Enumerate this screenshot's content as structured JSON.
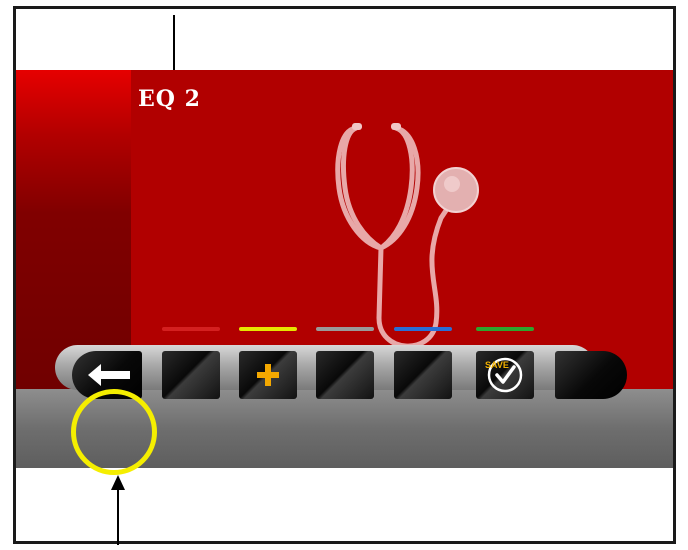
{
  "screen": {
    "title": "EQ 2",
    "illustration": "stethoscope-icon"
  },
  "toolbar": {
    "keys": [
      {
        "name": "back",
        "icon": "back-arrow-icon",
        "bar_color": null
      },
      {
        "name": "f1",
        "icon": null,
        "bar_color": "#d42020"
      },
      {
        "name": "f2",
        "icon": "plus-icon",
        "bar_color": "#e6e600"
      },
      {
        "name": "f3",
        "icon": null,
        "bar_color": "#9a9a9a"
      },
      {
        "name": "f4",
        "icon": null,
        "bar_color": "#2a6fd6"
      },
      {
        "name": "f5",
        "icon": "save-check-icon",
        "bar_color": "#2ea52e"
      },
      {
        "name": "f6",
        "icon": null,
        "bar_color": null
      }
    ],
    "save_label": "SAVE"
  },
  "annotations": {
    "highlight_color": "#f5ee00",
    "arrows": [
      "pointer-arrow-top",
      "pointer-arrow-bottom"
    ]
  }
}
